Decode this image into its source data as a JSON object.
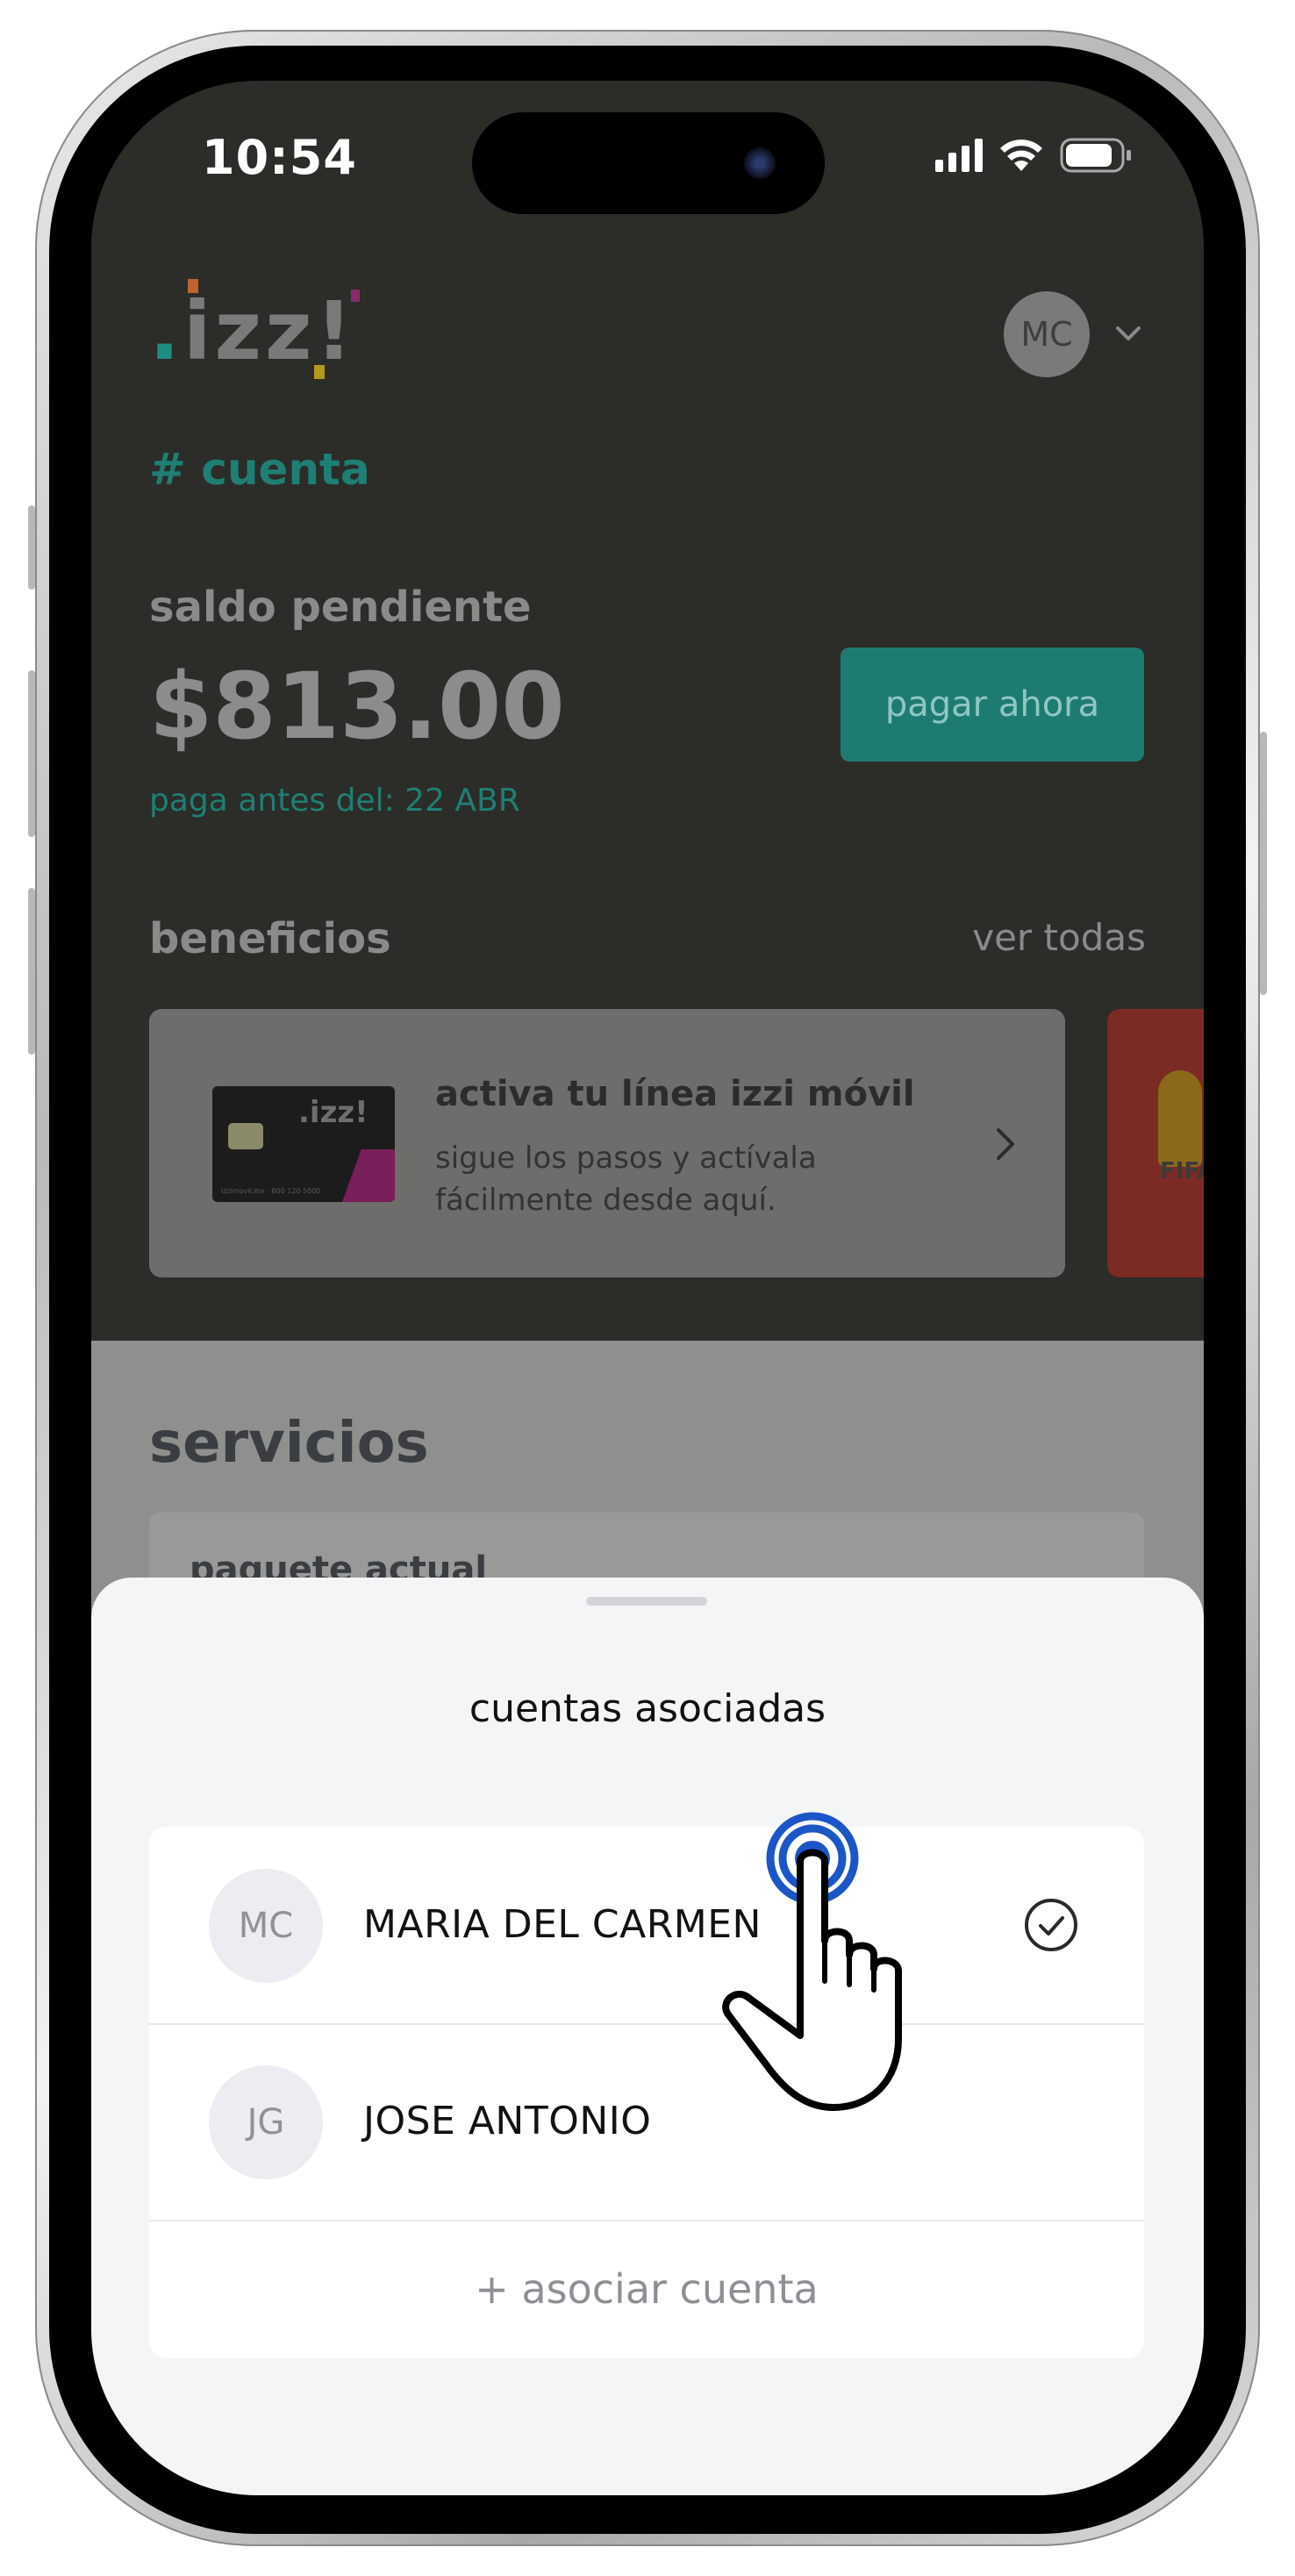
{
  "status_bar": {
    "time": "10:54"
  },
  "header": {
    "logo_text": "izz!",
    "user_initials": "MC",
    "account_tag": "# cuenta"
  },
  "balance": {
    "label": "saldo pendiente",
    "amount": "$813.00",
    "due_date": "paga antes del: 22 ABR",
    "pay_button": "pagar ahora"
  },
  "benefits": {
    "title": "beneficios",
    "see_all": "ver todas",
    "cards": [
      {
        "title": "activa tu línea izzi móvil",
        "description": "sigue los pasos y actívala fácilmente desde aquí."
      },
      {
        "partial_label": "FIFA"
      }
    ]
  },
  "services": {
    "title": "servicios",
    "card_label": "paquete actual"
  },
  "sheet": {
    "title": "cuentas asociadas",
    "accounts": [
      {
        "initials": "MC",
        "name": "MARIA DEL CARMEN",
        "selected": true
      },
      {
        "initials": "JG",
        "name": "JOSE ANTONIO",
        "selected": false
      }
    ],
    "add_account": "+ asociar cuenta"
  },
  "colors": {
    "brand_teal": "#1e7f74",
    "selected_check": "#2a2a2a",
    "tap_indicator": "#1b56c7"
  },
  "icons": [
    "signal-icon",
    "wifi-icon",
    "battery-icon",
    "chevron-down-icon",
    "chevron-right-icon",
    "check-circle-icon",
    "hand-pointer-icon"
  ]
}
